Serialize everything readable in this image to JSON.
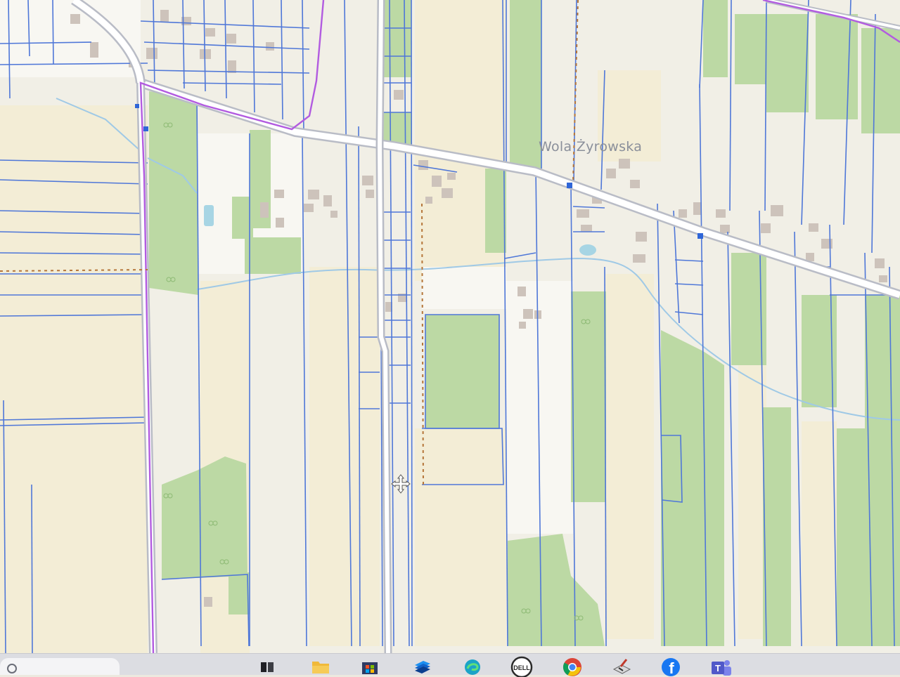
{
  "map": {
    "place_label": "Wola Żyrowska",
    "colors": {
      "background": "#f1efe6",
      "meadow_cream": "#f3edd6",
      "field_light": "#f7f6f1",
      "forest_green": "#bcd9a4",
      "forest_dark": "#a9cf8f",
      "parcel_line": "#4f77d8",
      "road_fill": "#ffffff",
      "road_casing": "#b9bcc6",
      "boundary": "#b25be0",
      "stream": "#9fc9e6",
      "building": "#cdc3bb",
      "dirt_track": "#b5763a"
    }
  },
  "taskbar": {
    "icons": [
      {
        "name": "search-icon"
      },
      {
        "name": "task-view-icon"
      },
      {
        "name": "file-explorer-icon"
      },
      {
        "name": "store-icon"
      },
      {
        "name": "stack-app-icon"
      },
      {
        "name": "edge-browser-icon"
      },
      {
        "name": "dell-icon",
        "text": "DELL"
      },
      {
        "name": "chrome-icon"
      },
      {
        "name": "paint-icon"
      },
      {
        "name": "facebook-icon",
        "text": "f"
      },
      {
        "name": "teams-icon",
        "text": "T"
      }
    ]
  }
}
